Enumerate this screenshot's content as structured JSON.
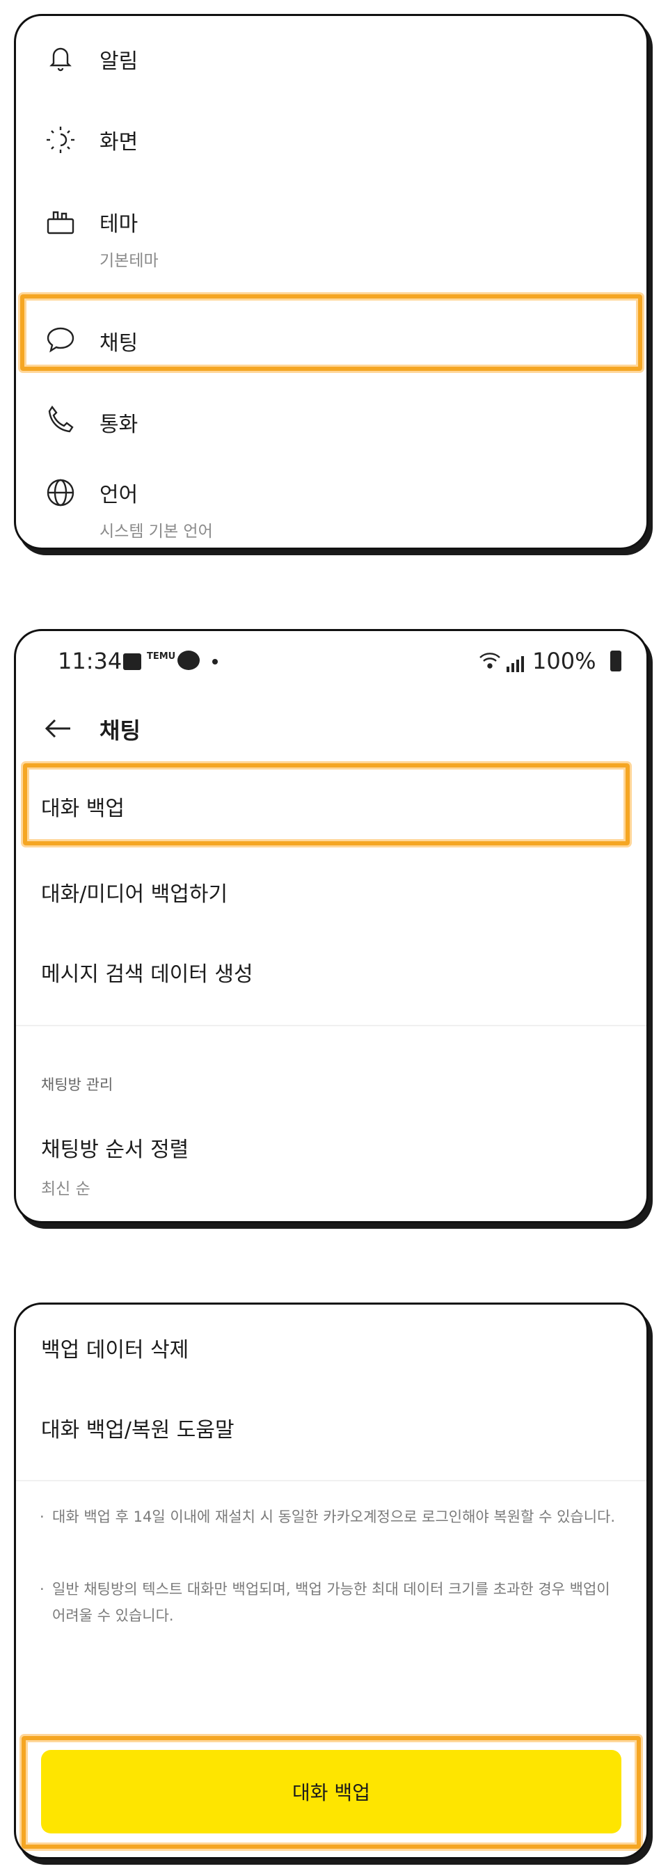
{
  "settings_menu": {
    "items": [
      {
        "label": "알림",
        "icon": "bell-icon"
      },
      {
        "label": "화면",
        "icon": "brightness-icon"
      },
      {
        "label": "테마",
        "sub": "기본테마",
        "icon": "paint-brush-icon"
      },
      {
        "label": "채팅",
        "icon": "chat-bubble-icon"
      },
      {
        "label": "통화",
        "icon": "phone-icon"
      },
      {
        "label": "언어",
        "sub": "시스템 기본 언어",
        "icon": "globe-icon"
      }
    ]
  },
  "status_bar": {
    "time": "11:34",
    "temu_label": "TEMU",
    "battery": "100%"
  },
  "chat_settings": {
    "title": "채팅",
    "items": [
      {
        "label": "대화 백업"
      },
      {
        "label": "대화/미디어 백업하기"
      },
      {
        "label": "메시지 검색 데이터 생성"
      }
    ],
    "section_title": "채팅방 관리",
    "sort": {
      "label": "채팅방 순서 정렬",
      "sub": "최신 순"
    }
  },
  "backup_screen": {
    "items": [
      {
        "label": "백업 데이터 삭제"
      },
      {
        "label": "대화 백업/복원 도움말"
      }
    ],
    "notes": [
      "대화 백업 후 14일 이내에 재설치 시 동일한 카카오계정으로 로그인해야 복원할 수 있습니다.",
      "일반 채팅방의 텍스트 대화만 백업되며, 백업 가능한 최대 데이터 크기를 초과한 경우 백업이 어려울 수 있습니다."
    ],
    "button_label": "대화 백업"
  },
  "colors": {
    "highlight": "#f5a623",
    "button": "#fee500"
  }
}
